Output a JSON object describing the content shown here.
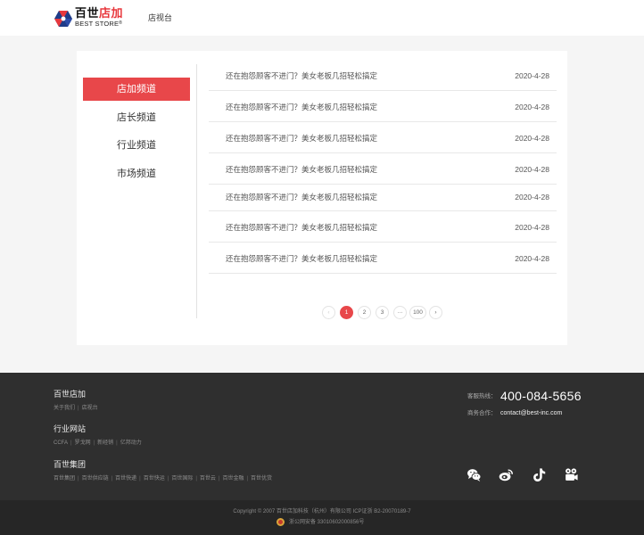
{
  "header": {
    "logo_cn_black": "百世",
    "logo_cn_red": "店加",
    "logo_en": "BEST STORE",
    "logo_reg": "®",
    "nav_link": "店视台",
    "brand_red": "#e8383d"
  },
  "sidebar": {
    "items": [
      {
        "label": "店加频道",
        "active": true
      },
      {
        "label": "店长频道",
        "active": false
      },
      {
        "label": "行业频道",
        "active": false
      },
      {
        "label": "市场频道",
        "active": false
      }
    ]
  },
  "articles": [
    {
      "title": "还在抱怨顾客不进门？美女老板几招轻松搞定",
      "date": "2020-4-28"
    },
    {
      "title": "还在抱怨顾客不进门？美女老板几招轻松搞定",
      "date": "2020-4-28"
    },
    {
      "title": "还在抱怨顾客不进门？美女老板几招轻松搞定",
      "date": "2020-4-28"
    },
    {
      "title": "还在抱怨顾客不进门？美女老板几招轻松搞定",
      "date": "2020-4-28"
    },
    {
      "title": "还在抱怨顾客不进门？美女老板几招轻松搞定",
      "date": "2020-4-28"
    },
    {
      "title": "还在抱怨顾客不进门？美女老板几招轻松搞定",
      "date": "2020-4-28"
    },
    {
      "title": "还在抱怨顾客不进门？美女老板几招轻松搞定",
      "date": "2020-4-28"
    }
  ],
  "pagination": {
    "prev": "‹",
    "pages": [
      "1",
      "2",
      "3"
    ],
    "current": "1",
    "ellipsis": "···",
    "last": "100",
    "next": "›"
  },
  "footer": {
    "section1": {
      "title": "百世店加",
      "links": [
        "关于我们",
        "店视台"
      ]
    },
    "section2": {
      "title": "行业网站",
      "links": [
        "CCFA",
        "罗戈网",
        "新经销",
        "亿邦动力"
      ]
    },
    "section3": {
      "title": "百世集团",
      "links": [
        "百世集团",
        "百世供应链",
        "百世快递",
        "百世快运",
        "百世国际",
        "百世云",
        "百世金融",
        "百世优货"
      ]
    },
    "hotline_label": "客服热线：",
    "hotline": "400-084-5656",
    "business_label": "商务合作：",
    "email": "contact@best-inc.com",
    "social_icons": [
      "wechat-icon",
      "weibo-icon",
      "douyin-icon",
      "video-icon"
    ],
    "copyright": "Copyright © 2007 百世店加科技（杭州）有限公司  ICP证浙 B2-20070189-7",
    "beian": "浙公网安备 33010602000856号"
  }
}
